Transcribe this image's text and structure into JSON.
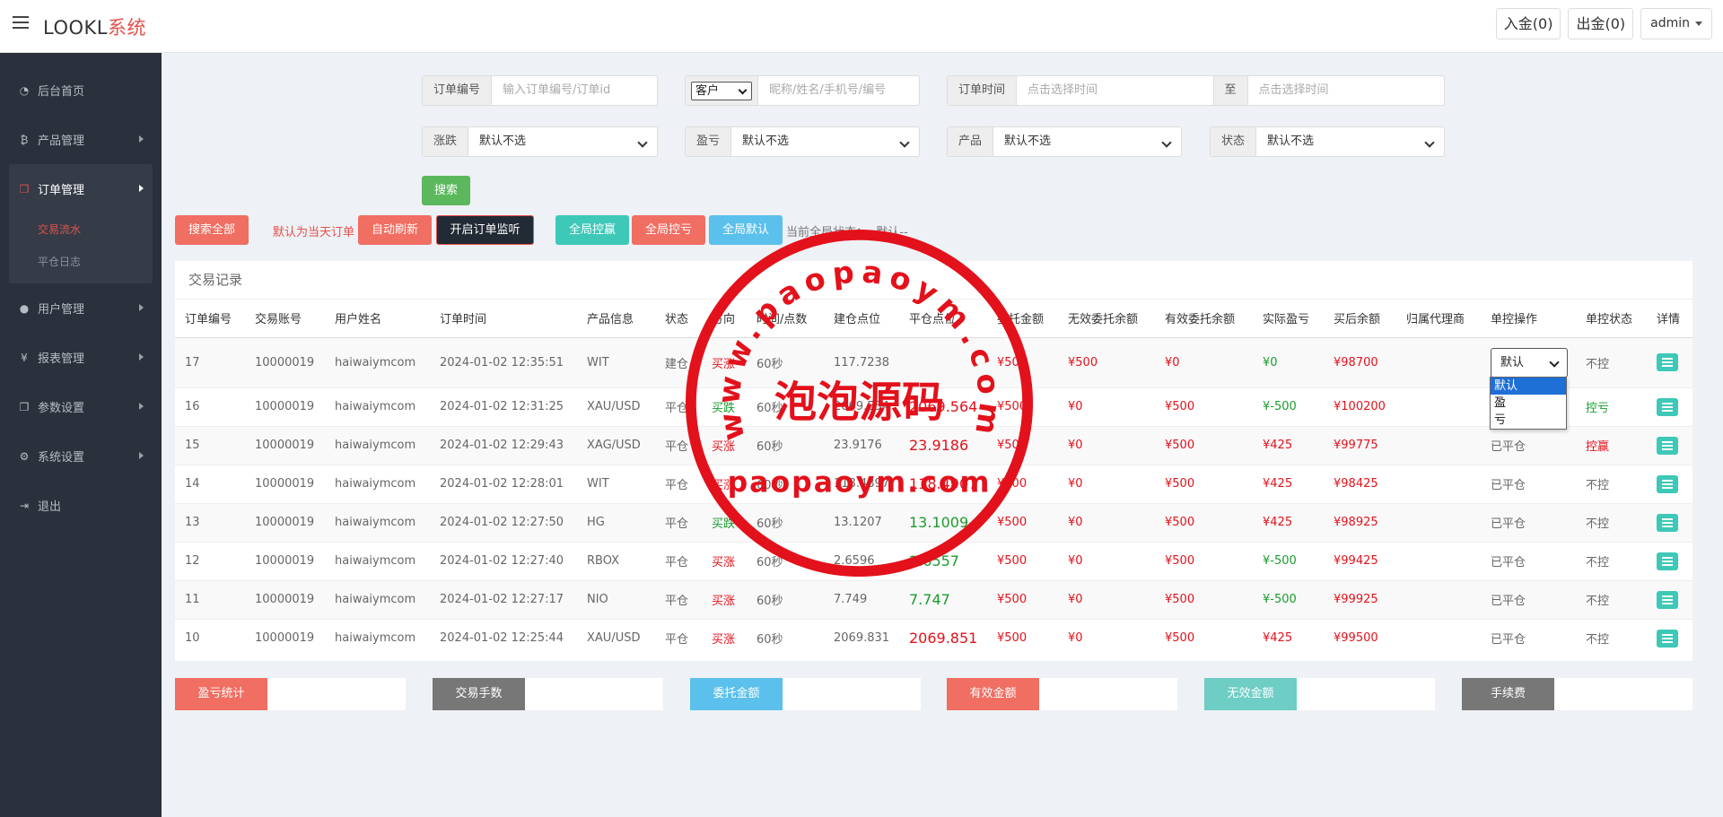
{
  "app": {
    "logo_main": "LOOKL",
    "logo_accent": "系统"
  },
  "topbar": {
    "deposit": "入金(0)",
    "withdraw": "出金(0)",
    "user": "admin"
  },
  "sidebar": {
    "items": [
      {
        "label": "后台首页",
        "icon": "dashboard-icon"
      },
      {
        "label": "产品管理",
        "icon": "bitcoin-icon"
      },
      {
        "label": "订单管理",
        "icon": "copy-icon",
        "children": [
          "交易流水",
          "平仓日志"
        ]
      },
      {
        "label": "用户管理",
        "icon": "user-icon"
      },
      {
        "label": "报表管理",
        "icon": "yen-icon"
      },
      {
        "label": "参数设置",
        "icon": "copy-icon"
      },
      {
        "label": "系统设置",
        "icon": "gears-icon"
      },
      {
        "label": "退出",
        "icon": "sign-out-icon"
      }
    ]
  },
  "filters": {
    "order_no_label": "订单编号",
    "order_no_placeholder": "输入订单编号/订单id",
    "customer_type": "客户",
    "customer_placeholder": "昵称/姓名/手机号/编号",
    "order_time_label": "订单时间",
    "time_start_placeholder": "点击选择时间",
    "to_label": "至",
    "time_end_placeholder": "点击选择时间",
    "rise_fall_label": "涨跌",
    "rise_fall_value": "默认不选",
    "profit_label": "盈亏",
    "profit_value": "默认不选",
    "product_label": "产品",
    "product_value": "默认不选",
    "status_label": "状态",
    "status_value": "默认不选",
    "search_button": "搜索"
  },
  "actions": {
    "search_all": "搜索全部",
    "default_notice": "默认为当天订单",
    "auto_refresh": "自动刷新",
    "order_monitor": "开启订单监听",
    "global_win": "全局控赢",
    "global_loss": "全局控亏",
    "global_default": "全局默认",
    "global_status": "当前全局状态：--默认--"
  },
  "table": {
    "title": "交易记录",
    "headers": [
      "订单编号",
      "交易账号",
      "用户姓名",
      "订单时间",
      "产品信息",
      "状态",
      "方向",
      "时间/点数",
      "建仓点位",
      "平仓点位",
      "委托金额",
      "无效委托余额",
      "有效委托余额",
      "实际盈亏",
      "买后余额",
      "归属代理商",
      "单控操作",
      "单控状态",
      "详情"
    ],
    "rows": [
      {
        "id": "17",
        "account": "10000019",
        "name": "haiwaiymcom",
        "time": "2024-01-02 12:35:51",
        "product": "WIT",
        "status": "建仓",
        "direction": "买涨",
        "dir_color": "red",
        "duration": "60秒",
        "open": "117.7238",
        "close": "",
        "close_color": "red",
        "amount": "¥500",
        "invalid": "¥500",
        "valid": "¥0",
        "pnl": "¥0",
        "pnl_color": "green",
        "balance": "¥98700",
        "agent": "",
        "op": "默认",
        "ctrl": "不控",
        "ctrl_color": "gray"
      },
      {
        "id": "16",
        "account": "10000019",
        "name": "haiwaiymcom",
        "time": "2024-01-02 12:31:25",
        "product": "XAU/USD",
        "status": "平仓",
        "direction": "买跌",
        "dir_color": "green",
        "duration": "60秒",
        "open": "2069.554",
        "close": "2069.564",
        "close_color": "red",
        "amount": "¥500",
        "invalid": "¥0",
        "valid": "¥500",
        "pnl": "¥-500",
        "pnl_color": "green",
        "balance": "¥100200",
        "agent": "",
        "op": "已平仓",
        "ctrl": "控亏",
        "ctrl_color": "green"
      },
      {
        "id": "15",
        "account": "10000019",
        "name": "haiwaiymcom",
        "time": "2024-01-02 12:29:43",
        "product": "XAG/USD",
        "status": "平仓",
        "direction": "买涨",
        "dir_color": "red",
        "duration": "60秒",
        "open": "23.9176",
        "close": "23.9186",
        "close_color": "red",
        "amount": "¥500",
        "invalid": "¥0",
        "valid": "¥500",
        "pnl": "¥425",
        "pnl_color": "red",
        "balance": "¥99775",
        "agent": "",
        "op": "已平仓",
        "ctrl": "控赢",
        "ctrl_color": "red"
      },
      {
        "id": "14",
        "account": "10000019",
        "name": "haiwaiymcom",
        "time": "2024-01-02 12:28:01",
        "product": "WIT",
        "status": "平仓",
        "direction": "买涨",
        "dir_color": "red",
        "duration": "60秒",
        "open": "118.4897",
        "close": "118.4907",
        "close_color": "red",
        "amount": "¥500",
        "invalid": "¥0",
        "valid": "¥500",
        "pnl": "¥425",
        "pnl_color": "red",
        "balance": "¥98425",
        "agent": "",
        "op": "已平仓",
        "ctrl": "不控",
        "ctrl_color": "gray"
      },
      {
        "id": "13",
        "account": "10000019",
        "name": "haiwaiymcom",
        "time": "2024-01-02 12:27:50",
        "product": "HG",
        "status": "平仓",
        "direction": "买跌",
        "dir_color": "green",
        "duration": "60秒",
        "open": "13.1207",
        "close": "13.1009",
        "close_color": "green",
        "amount": "¥500",
        "invalid": "¥0",
        "valid": "¥500",
        "pnl": "¥425",
        "pnl_color": "red",
        "balance": "¥98925",
        "agent": "",
        "op": "已平仓",
        "ctrl": "不控",
        "ctrl_color": "gray"
      },
      {
        "id": "12",
        "account": "10000019",
        "name": "haiwaiymcom",
        "time": "2024-01-02 12:27:40",
        "product": "RBOX",
        "status": "平仓",
        "direction": "买涨",
        "dir_color": "red",
        "duration": "60秒",
        "open": "2.6596",
        "close": "2.6557",
        "close_color": "green",
        "amount": "¥500",
        "invalid": "¥0",
        "valid": "¥500",
        "pnl": "¥-500",
        "pnl_color": "green",
        "balance": "¥99425",
        "agent": "",
        "op": "已平仓",
        "ctrl": "不控",
        "ctrl_color": "gray"
      },
      {
        "id": "11",
        "account": "10000019",
        "name": "haiwaiymcom",
        "time": "2024-01-02 12:27:17",
        "product": "NIO",
        "status": "平仓",
        "direction": "买涨",
        "dir_color": "red",
        "duration": "60秒",
        "open": "7.749",
        "close": "7.747",
        "close_color": "green",
        "amount": "¥500",
        "invalid": "¥0",
        "valid": "¥500",
        "pnl": "¥-500",
        "pnl_color": "green",
        "balance": "¥99925",
        "agent": "",
        "op": "已平仓",
        "ctrl": "不控",
        "ctrl_color": "gray"
      },
      {
        "id": "10",
        "account": "10000019",
        "name": "haiwaiymcom",
        "time": "2024-01-02 12:25:44",
        "product": "XAU/USD",
        "status": "平仓",
        "direction": "买涨",
        "dir_color": "red",
        "duration": "60秒",
        "open": "2069.831",
        "close": "2069.851",
        "close_color": "red",
        "amount": "¥500",
        "invalid": "¥0",
        "valid": "¥500",
        "pnl": "¥425",
        "pnl_color": "red",
        "balance": "¥99500",
        "agent": "",
        "op": "已平仓",
        "ctrl": "不控",
        "ctrl_color": "gray"
      }
    ]
  },
  "dropdown": {
    "options": [
      "默认",
      "盈",
      "亏"
    ],
    "selected": 0
  },
  "stats": [
    {
      "label": "盈亏统计",
      "color": "#f06e62",
      "value": ""
    },
    {
      "label": "交易手数",
      "color": "#777777",
      "value": ""
    },
    {
      "label": "委托金额",
      "color": "#5bc0eb",
      "value": ""
    },
    {
      "label": "有效金额",
      "color": "#f06e62",
      "value": ""
    },
    {
      "label": "无效金额",
      "color": "#6ecdc5",
      "value": ""
    },
    {
      "label": "手续费",
      "color": "#777777",
      "value": ""
    }
  ],
  "watermark": {
    "arc_text": "www.paopaoym.com",
    "center_text": "泡泡源码",
    "bottom_text": "paopaoym.com"
  }
}
